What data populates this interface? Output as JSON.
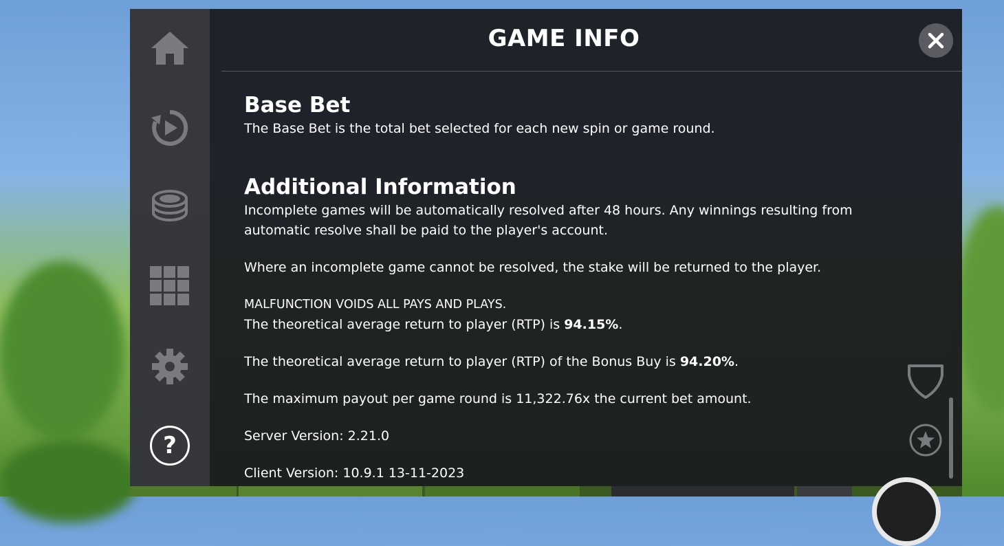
{
  "header": {
    "title": "GAME INFO",
    "close_label": "✕"
  },
  "sidebar": {
    "items": [
      {
        "name": "home",
        "icon": "home-icon"
      },
      {
        "name": "autoplay",
        "icon": "autoplay-icon"
      },
      {
        "name": "bet",
        "icon": "coins-icon"
      },
      {
        "name": "paytable",
        "icon": "grid-icon"
      },
      {
        "name": "settings",
        "icon": "gear-icon"
      },
      {
        "name": "help",
        "icon": "help-icon",
        "label": "?"
      }
    ]
  },
  "content": {
    "base_bet_heading": "Base Bet",
    "base_bet_text": "The Base Bet is the total bet selected for each new spin or game round.",
    "additional_heading": "Additional Information",
    "incomplete_text": "Incomplete games will be automatically resolved after 48 hours. Any winnings resulting from automatic resolve shall be paid to the player's account.",
    "unresolved_text": "Where an incomplete game cannot be resolved, the stake will be returned to the player.",
    "malfunction_text": "MALFUNCTION VOIDS ALL PAYS AND PLAYS.",
    "rtp_prefix": "The theoretical average return to player (RTP) is ",
    "rtp_value": "94.15%",
    "rtp_suffix": ".",
    "rtp_bonus_prefix": "The theoretical average return to player (RTP) of the Bonus Buy is ",
    "rtp_bonus_value": "94.20%",
    "rtp_bonus_suffix": ".",
    "max_payout_text": "The maximum payout per game round is 11,322.76x the current bet amount.",
    "server_version": "Server Version: 2.21.0",
    "client_version": "Client Version: 10.9.1 13-11-2023"
  },
  "right_controls": [
    {
      "name": "shield",
      "icon": "shield-icon"
    },
    {
      "name": "favorite",
      "icon": "star-icon"
    }
  ],
  "colors": {
    "modal_bg": "#181a1e",
    "sidebar_bg": "#3a3a3e",
    "icon_gray": "#7a7b7f",
    "text": "#ffffff"
  }
}
